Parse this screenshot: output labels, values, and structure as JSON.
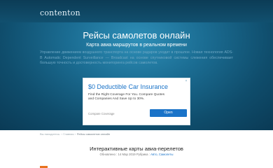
{
  "header": {
    "logo": "contenton"
  },
  "hero": {
    "title": "Рейсы самолетов онлайн",
    "subtitle": "Карта авиа маршрутов в реальном времени",
    "description": "Управление движением воздушного транспорта на основе радаров уходит в прошлое. Новая технология ADS-B Automatic Dependent Surveillance — Broadcast на основе спутниковой системы слежения обеспечивает большую точность и достоверность мониторинга рейсов самолетов."
  },
  "ad": {
    "close": "×",
    "headline": "$0 Deductible Car Insurance",
    "body": "Find the Right Coverage For You. Compare Quotes and Companies And Save Up to 30%.",
    "advertiser": "Compare Coverage",
    "cta": "Open"
  },
  "breadcrumb": {
    "items": [
      "Вы находитесь:",
      "Главная",
      "Рейсы самолетов онлайн"
    ],
    "separator": "›"
  },
  "article": {
    "title": "Интерактивные карты авиа-перелетов",
    "meta_prefix": "Обновлено : 14 Мар 2019 Рубрика :",
    "category": "Авто, Самолеты"
  },
  "colors": {
    "accent": "#1a73c8",
    "orange": "#e8731f"
  }
}
